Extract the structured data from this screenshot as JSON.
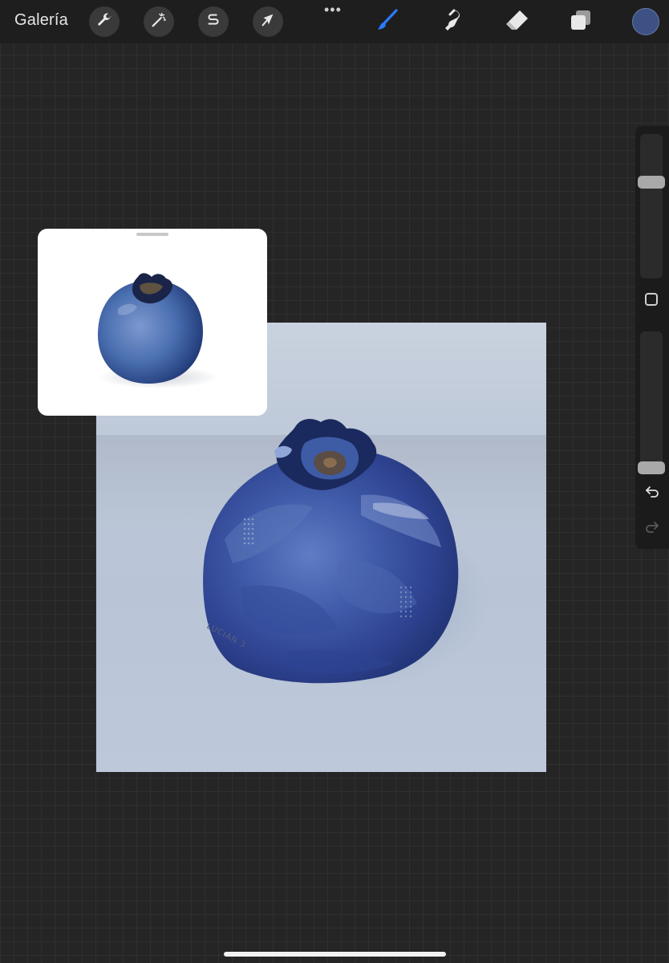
{
  "toolbar": {
    "gallery_label": "Galería",
    "more_label": "•••",
    "left_tools": [
      {
        "icon": "wrench-icon"
      },
      {
        "icon": "magic-wand-icon"
      },
      {
        "icon": "selection-s-icon"
      },
      {
        "icon": "arrow-cursor-icon"
      }
    ],
    "right_tools": [
      {
        "icon": "brush-icon",
        "active": true
      },
      {
        "icon": "smudge-icon"
      },
      {
        "icon": "eraser-icon"
      },
      {
        "icon": "layers-icon"
      }
    ],
    "current_color": "#3d5185",
    "active_tool_color": "#2a7bff"
  },
  "canvas": {
    "signature": "LUCIAN 3",
    "background_color": "#bcc7d8",
    "subject_color": "#3e5ca6"
  },
  "reference": {
    "subject_color": "#4a6fb0"
  },
  "sidebar": {
    "brush_size_level": 0.68,
    "opacity_level": 0.0
  }
}
